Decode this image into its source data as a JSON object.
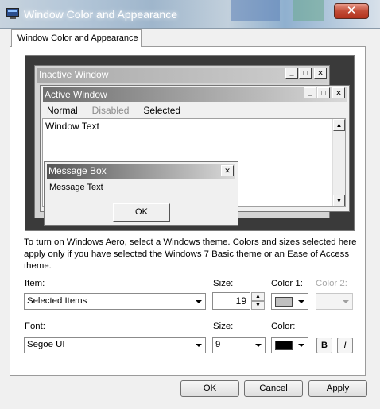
{
  "window": {
    "title": "Window Color and Appearance",
    "close_glyph": "✕"
  },
  "tab": {
    "label": "Window Color and Appearance"
  },
  "preview": {
    "inactive_title": "Inactive Window",
    "active_title": "Active Window",
    "menu": {
      "normal": "Normal",
      "disabled": "Disabled",
      "selected": "Selected"
    },
    "window_text": "Window Text",
    "message_box_title": "Message Box",
    "message_text": "Message Text",
    "ok_label": "OK",
    "caption_glyphs": {
      "minimize": "_",
      "maximize": "□",
      "close": "✕"
    }
  },
  "info_text": "To turn on Windows Aero, select a Windows theme.  Colors and sizes selected here apply only if you have selected the Windows 7 Basic theme or an Ease of Access theme.",
  "item_row": {
    "item_label": "Item:",
    "item_value": "Selected Items",
    "size_label": "Size:",
    "size_value": "19",
    "color1_label": "Color 1:",
    "color1_value": "#c0c0c0",
    "color2_label": "Color 2:"
  },
  "font_row": {
    "font_label": "Font:",
    "font_value": "Segoe UI",
    "size_label": "Size:",
    "size_value": "9",
    "color_label": "Color:",
    "color_value": "#000000",
    "bold_label": "B",
    "italic_label": "I"
  },
  "footer": {
    "ok": "OK",
    "cancel": "Cancel",
    "apply": "Apply"
  }
}
